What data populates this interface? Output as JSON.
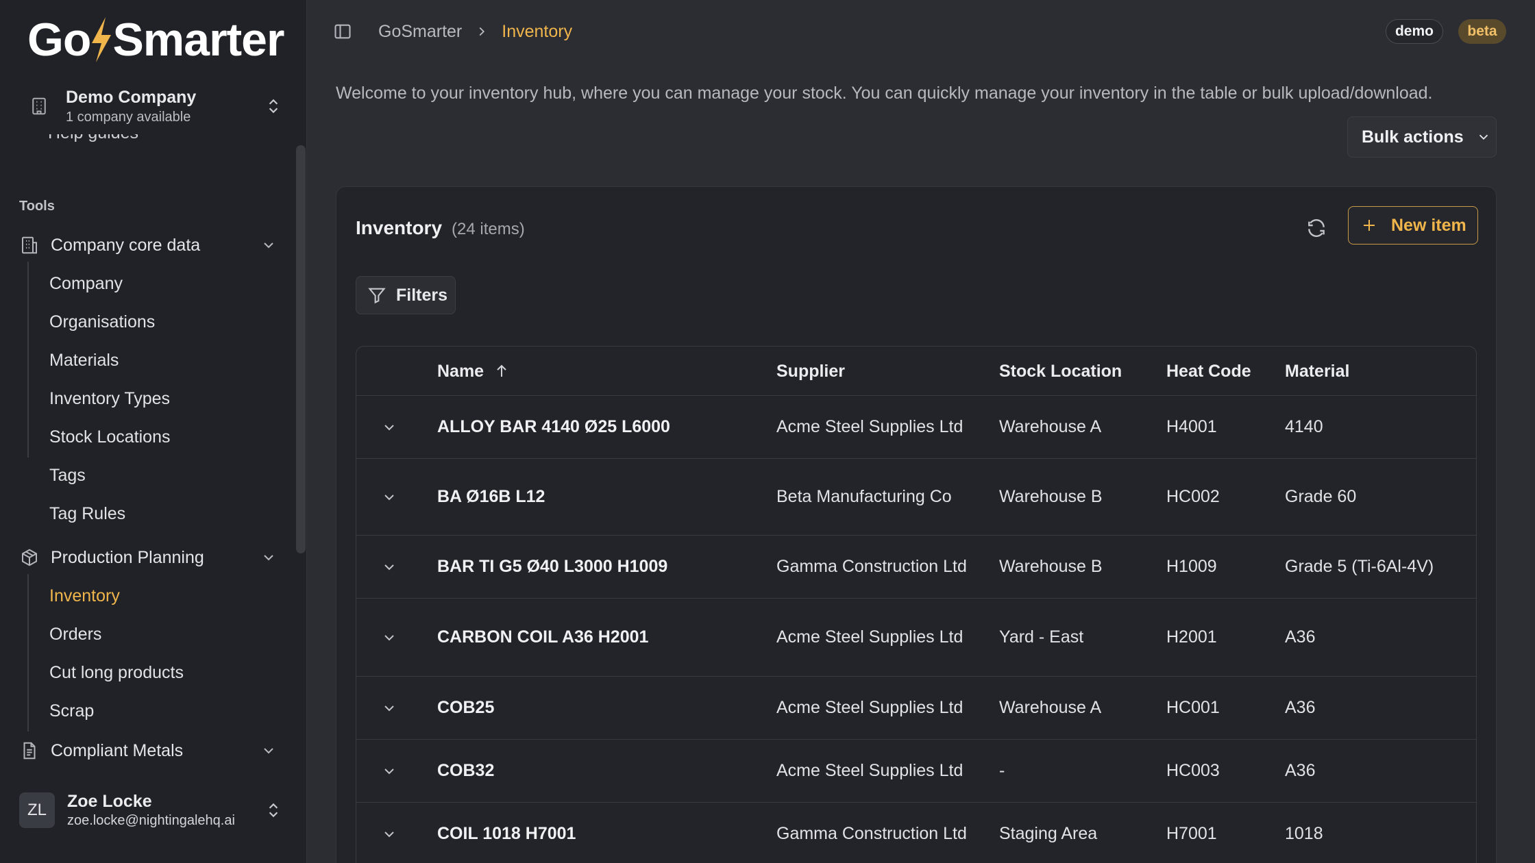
{
  "brand": {
    "logo_left": "Go",
    "logo_right": "Smarter",
    "accent": "#f0b54b"
  },
  "company": {
    "name": "Demo Company",
    "subtitle": "1 company available"
  },
  "sidebar": {
    "cut_item": "Help guides",
    "section_label": "Tools",
    "groups": [
      {
        "label": "Company core data",
        "icon": "building-icon",
        "items": [
          "Company",
          "Organisations",
          "Materials",
          "Inventory Types",
          "Stock Locations",
          "Tags",
          "Tag Rules"
        ]
      },
      {
        "label": "Production Planning",
        "icon": "box-icon",
        "items": [
          "Inventory",
          "Orders",
          "Cut long products",
          "Scrap"
        ]
      },
      {
        "label": "Compliant Metals",
        "icon": "document-icon",
        "items": []
      }
    ],
    "active_item": "Inventory"
  },
  "user": {
    "initials": "ZL",
    "name": "Zoe Locke",
    "email": "zoe.locke@nightingalehq.ai"
  },
  "topbar": {
    "breadcrumb_root": "GoSmarter",
    "breadcrumb_current": "Inventory",
    "badge_demo": "demo",
    "badge_beta": "beta"
  },
  "page": {
    "welcome": "Welcome to your inventory hub, where you can manage your stock. You can quickly manage your inventory in the table or bulk upload/download.",
    "bulk_actions_label": "Bulk actions"
  },
  "inventory": {
    "title": "Inventory",
    "count_label": "(24 items)",
    "new_item_label": "New item",
    "filters_label": "Filters",
    "columns": [
      "Name",
      "Supplier",
      "Stock Location",
      "Heat Code",
      "Material"
    ],
    "rows": [
      {
        "name": "ALLOY BAR 4140 Ø25 L6000",
        "supplier": "Acme Steel Supplies Ltd",
        "location": "Warehouse A",
        "heat_code": "H4001",
        "material": "4140"
      },
      {
        "name": "BA Ø16B L12",
        "supplier": "Beta Manufacturing Co",
        "location": "Warehouse B",
        "heat_code": "HC002",
        "material": "Grade 60"
      },
      {
        "name": "BAR TI G5 Ø40 L3000 H1009",
        "supplier": "Gamma Construction Ltd",
        "location": "Warehouse B",
        "heat_code": "H1009",
        "material": "Grade 5 (Ti-6Al-4V)"
      },
      {
        "name": "CARBON COIL A36 H2001",
        "supplier": "Acme Steel Supplies Ltd",
        "location": "Yard - East",
        "heat_code": "H2001",
        "material": "A36"
      },
      {
        "name": "COB25",
        "supplier": "Acme Steel Supplies Ltd",
        "location": "Warehouse A",
        "heat_code": "HC001",
        "material": "A36"
      },
      {
        "name": "COB32",
        "supplier": "Acme Steel Supplies Ltd",
        "location": "-",
        "heat_code": "HC003",
        "material": "A36"
      },
      {
        "name": "COIL 1018 H7001",
        "supplier": "Gamma Construction Ltd",
        "location": "Staging Area",
        "heat_code": "H7001",
        "material": "1018"
      }
    ]
  }
}
